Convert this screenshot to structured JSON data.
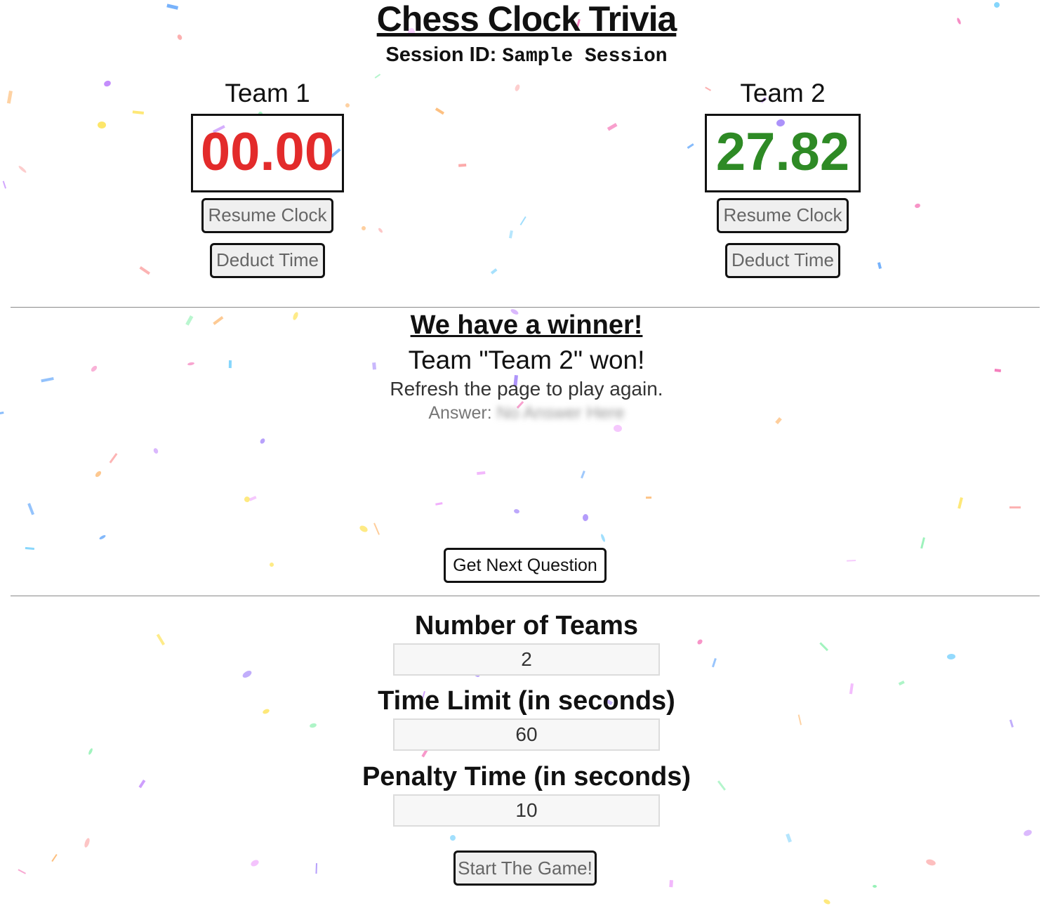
{
  "header": {
    "title": "Chess Clock Trivia",
    "session_label": "Session ID:",
    "session_id": "Sample Session"
  },
  "teams": [
    {
      "name": "Team 1",
      "time": "00.00",
      "resume_label": "Resume Clock",
      "deduct_label": "Deduct Time",
      "color": "#e32b2b"
    },
    {
      "name": "Team 2",
      "time": "27.82",
      "resume_label": "Resume Clock",
      "deduct_label": "Deduct Time",
      "color": "#2e8a25"
    }
  ],
  "result": {
    "heading": "We have a winner!",
    "message": "Team \"Team 2\" won!",
    "instruction": "Refresh the page to play again.",
    "answer_label": "Answer:",
    "answer_value": "No Answer Here"
  },
  "next_question_label": "Get Next Question",
  "settings": {
    "teams_label": "Number of Teams",
    "teams_value": "2",
    "time_limit_label": "Time Limit (in seconds)",
    "time_limit_value": "60",
    "penalty_label": "Penalty Time (in seconds)",
    "penalty_value": "10",
    "start_label": "Start The Game!"
  },
  "confetti_colors": [
    "#a78bfa",
    "#86efac",
    "#7dd3fc",
    "#fdba74",
    "#f0abfc",
    "#fde047",
    "#fca5a5",
    "#c084fc",
    "#60a5fa",
    "#f472b6"
  ]
}
